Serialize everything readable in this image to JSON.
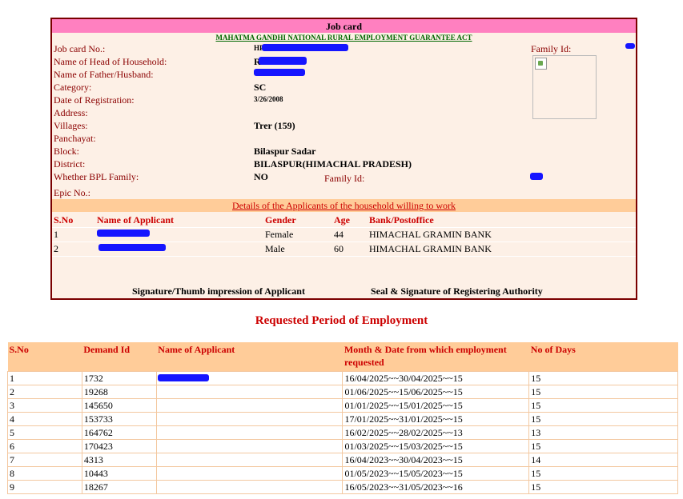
{
  "jobcard": {
    "title": "Job card",
    "act": "MAHATMA GANDHI NATIONAL RURAL EMPLOYMENT GUARANTEE ACT",
    "fields": {
      "job_card_no_label": "Job card No.:",
      "job_card_no_value": "HP",
      "head_label": "Name of Head of Household:",
      "head_value": "R",
      "father_label": "Name of Father/Husband:",
      "category_label": "Category:",
      "category_value": "SC",
      "registration_label": "Date of Registration:",
      "registration_value": "3/26/2008",
      "address_label": "Address:",
      "villages_label": "Villages:",
      "villages_value": "Trer (159)",
      "panchayat_label": "Panchayat:",
      "block_label": "Block:",
      "block_value": "Bilaspur Sadar",
      "district_label": "District:",
      "district_value": "BILASPUR(HIMACHAL PRADESH)",
      "bpl_label": "Whether BPL Family:",
      "bpl_value": "NO",
      "family_id_label": "Family Id:",
      "family_id_top_label": "Family Id:",
      "epic_label": "Epic No.:"
    },
    "applicants_section": "Details of the Applicants of the household willing to work",
    "applicant_headers": [
      "S.No",
      "Name of Applicant",
      "Gender",
      "Age",
      "Bank/Postoffice"
    ],
    "applicants": [
      {
        "sno": "1",
        "gender": "Female",
        "age": "44",
        "bank": "HIMACHAL GRAMIN BANK"
      },
      {
        "sno": "2",
        "gender": "Male",
        "age": "60",
        "bank": "HIMACHAL GRAMIN BANK"
      }
    ],
    "signature_applicant": "Signature/Thumb impression of Applicant",
    "signature_authority": "Seal & Signature of Registering Authority"
  },
  "requested": {
    "title": "Requested Period of Employment",
    "headers": [
      "S.No",
      "Demand Id",
      "Name of Applicant",
      "Month & Date from which employment requested",
      "No of Days"
    ],
    "rows": [
      {
        "sno": "1",
        "demand_id": "1732",
        "period": "16/04/2025~~30/04/2025~~15",
        "days": "15"
      },
      {
        "sno": "2",
        "demand_id": "19268",
        "period": "01/06/2025~~15/06/2025~~15",
        "days": "15"
      },
      {
        "sno": "3",
        "demand_id": "145650",
        "period": "01/01/2025~~15/01/2025~~15",
        "days": "15"
      },
      {
        "sno": "4",
        "demand_id": "153733",
        "period": "17/01/2025~~31/01/2025~~15",
        "days": "15"
      },
      {
        "sno": "5",
        "demand_id": "164762",
        "period": "16/02/2025~~28/02/2025~~13",
        "days": "13"
      },
      {
        "sno": "6",
        "demand_id": "170423",
        "period": "01/03/2025~~15/03/2025~~15",
        "days": "15"
      },
      {
        "sno": "7",
        "demand_id": "4313",
        "period": "16/04/2023~~30/04/2023~~15",
        "days": "14"
      },
      {
        "sno": "8",
        "demand_id": "10443",
        "period": "01/05/2023~~15/05/2023~~15",
        "days": "15"
      },
      {
        "sno": "9",
        "demand_id": "18267",
        "period": "16/05/2023~~31/05/2023~~16",
        "days": "15"
      }
    ]
  },
  "colors": {
    "title_bar": "#ff80c0",
    "section_bar": "#ffcc99",
    "card_background": "#fdf0e6",
    "label_red": "#8b0000",
    "header_red": "#cc0000",
    "redaction_blue": "#1515ff"
  }
}
